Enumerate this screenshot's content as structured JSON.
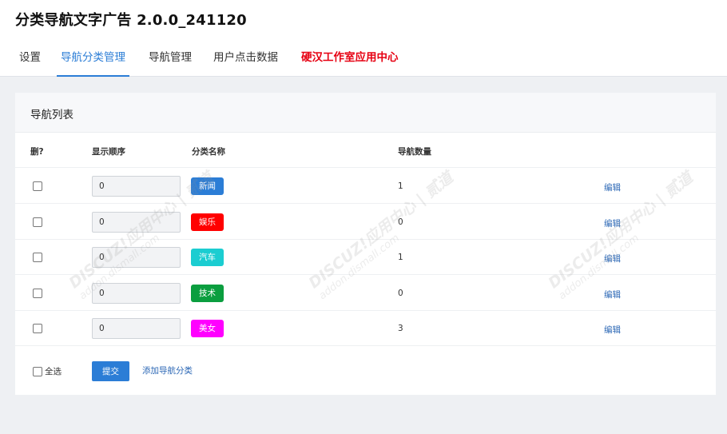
{
  "app": {
    "title": "分类导航文字广告 2.0.0_241120"
  },
  "tabs": [
    {
      "label": "设置"
    },
    {
      "label": "导航分类管理"
    },
    {
      "label": "导航管理"
    },
    {
      "label": "用户点击数据"
    },
    {
      "label": "硬汉工作室应用中心"
    }
  ],
  "panel": {
    "title": "导航列表",
    "columns": {
      "delete": "删?",
      "order": "显示顺序",
      "name": "分类名称",
      "count": "导航数量"
    }
  },
  "rows": [
    {
      "order": "0",
      "name": "新闻",
      "color": "#2b7dd6",
      "count": "1",
      "edit": "编辑"
    },
    {
      "order": "0",
      "name": "娱乐",
      "color": "#ff0000",
      "count": "0",
      "edit": "编辑"
    },
    {
      "order": "0",
      "name": "汽车",
      "color": "#1bcdd1",
      "count": "1",
      "edit": "编辑"
    },
    {
      "order": "0",
      "name": "技术",
      "color": "#0b9e3f",
      "count": "0",
      "edit": "编辑"
    },
    {
      "order": "0",
      "name": "美女",
      "color": "#ff00ff",
      "count": "3",
      "edit": "编辑"
    }
  ],
  "footer": {
    "select_all": "全选",
    "submit": "提交",
    "add_category": "添加导航分类"
  },
  "watermark": {
    "line1": "DISCUZ!应用中心 | 贰道",
    "line2": "addon.dismall.com"
  }
}
